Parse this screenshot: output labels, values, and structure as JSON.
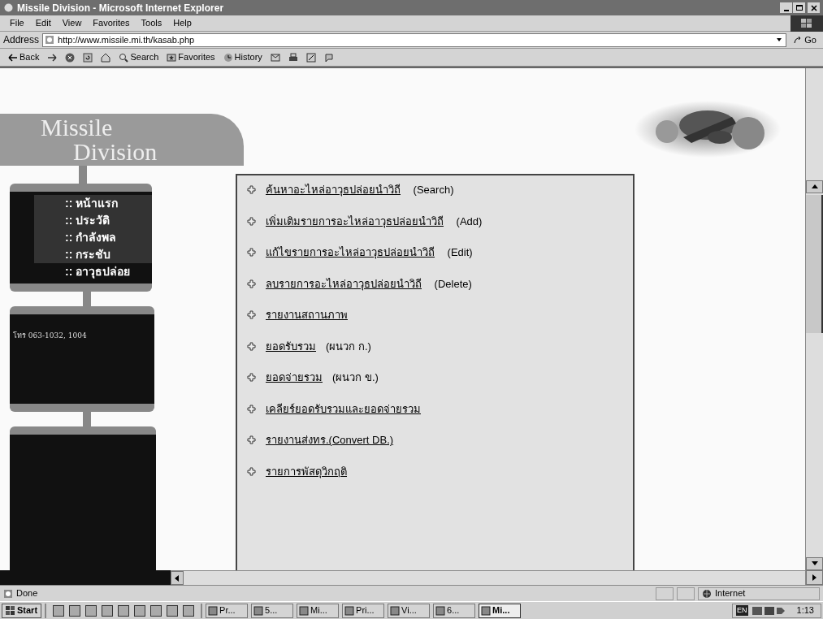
{
  "window": {
    "title": "Missile Division - Microsoft Internet Explorer"
  },
  "menu": [
    "File",
    "Edit",
    "View",
    "Favorites",
    "Tools",
    "Help"
  ],
  "address": {
    "label": "Address",
    "url": "http://www.missile.mi.th/kasab.php",
    "go": "Go"
  },
  "toolbar": [
    {
      "kind": "back",
      "label": "Back"
    },
    {
      "kind": "forward"
    },
    {
      "kind": "stop"
    },
    {
      "kind": "refresh"
    },
    {
      "kind": "home"
    },
    {
      "kind": "search",
      "label": "Search"
    },
    {
      "kind": "favorites",
      "label": "Favorites"
    },
    {
      "kind": "history",
      "label": "History"
    },
    {
      "kind": "mail"
    },
    {
      "kind": "print"
    },
    {
      "kind": "edit"
    },
    {
      "kind": "discuss"
    }
  ],
  "logo": {
    "line_1": "Missile",
    "line_2": "Division"
  },
  "nav": [
    {
      "label": ":: หน้าแรก",
      "highlighted": true
    },
    {
      "label": ":: ประวัติ",
      "highlighted": true
    },
    {
      "label": ":: กำลังพล",
      "highlighted": true
    },
    {
      "label": ":: กระชับ",
      "highlighted": true
    },
    {
      "label": ":: อาวุธปล่อย",
      "highlighted": false
    }
  ],
  "contact": "โทร 063-1032, 1004",
  "links": [
    {
      "link": "ค้นหาอะไหล่อาวุธปล่อยนำวิถี",
      "note": " (Search)"
    },
    {
      "link": "เพิ่มเติมรายการอะไหล่อาวุธปล่อยนำวิถี",
      "note": " (Add)"
    },
    {
      "link": "แก้ไขรายการอะไหล่อาวุธปล่อยนำวิถี",
      "note": " (Edit)"
    },
    {
      "link": "ลบรายการอะไหล่อาวุธปล่อยนำวิถี",
      "note": " (Delete)"
    },
    {
      "link": "รายงานสถานภาพ"
    },
    {
      "link": "ยอดรับรวม",
      "note": "(ผนวก ก.)"
    },
    {
      "link": "ยอดจ่ายรวม",
      "note": "(ผนวก ข.)"
    },
    {
      "link": "เคลียร์ยอดรับรวมและยอดจ่ายรวม"
    },
    {
      "link": "รายงานส่งทร.(Convert DB.)"
    },
    {
      "link": "รายการพัสดุวิกฤติ"
    }
  ],
  "status": {
    "text": "Done",
    "zone": "Internet"
  },
  "taskbar": {
    "start": "Start",
    "tasks": [
      {
        "label": "Pr...",
        "selected": false
      },
      {
        "label": "5...",
        "selected": false
      },
      {
        "label": "Mi...",
        "selected": false
      },
      {
        "label": "Pri...",
        "selected": false
      },
      {
        "label": "Vi...",
        "selected": false
      },
      {
        "label": "6...",
        "selected": false
      },
      {
        "label": "Mi...",
        "selected": true
      }
    ],
    "language": "EN",
    "clock": "1:13"
  }
}
